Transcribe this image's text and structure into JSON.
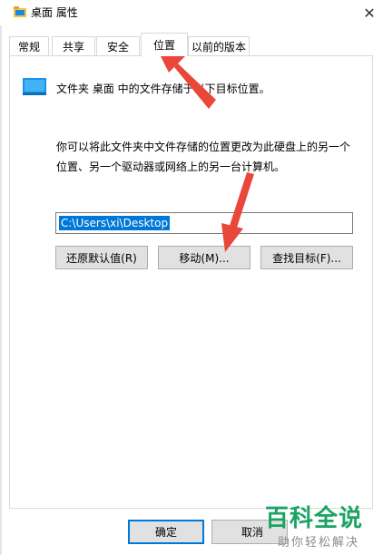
{
  "window": {
    "title": "桌面 属性",
    "close_glyph": "✕"
  },
  "tabs": [
    {
      "label": "常规",
      "active": false
    },
    {
      "label": "共享",
      "active": false
    },
    {
      "label": "安全",
      "active": false
    },
    {
      "label": "位置",
      "active": true
    },
    {
      "label": "以前的版本",
      "active": false
    }
  ],
  "location": {
    "folder_description": "文件夹 桌面 中的文件存储于以下目标位置。",
    "help_line_1": "你可以将此文件夹中文件存储的位置更改为此硬盘上的另一个",
    "help_line_2": "位置、另一个驱动器或网络上的另一台计算机。",
    "path_value": "C:\\Users\\xi\\Desktop",
    "restore_default_label": "还原默认值(R)",
    "move_label": "移动(M)...",
    "find_target_label": "查找目标(F)..."
  },
  "footer": {
    "ok_label": "确定",
    "cancel_label": "取消"
  },
  "watermark": {
    "main": "百科全说",
    "sub": "助你轻松解决"
  },
  "colors": {
    "accent": "#0078d7",
    "annotation_arrow": "#e8473a",
    "watermark_green": "#1aa463"
  },
  "icons": {
    "title": "folder-icon",
    "folder": "desktop-folder-icon",
    "close": "close-icon"
  }
}
